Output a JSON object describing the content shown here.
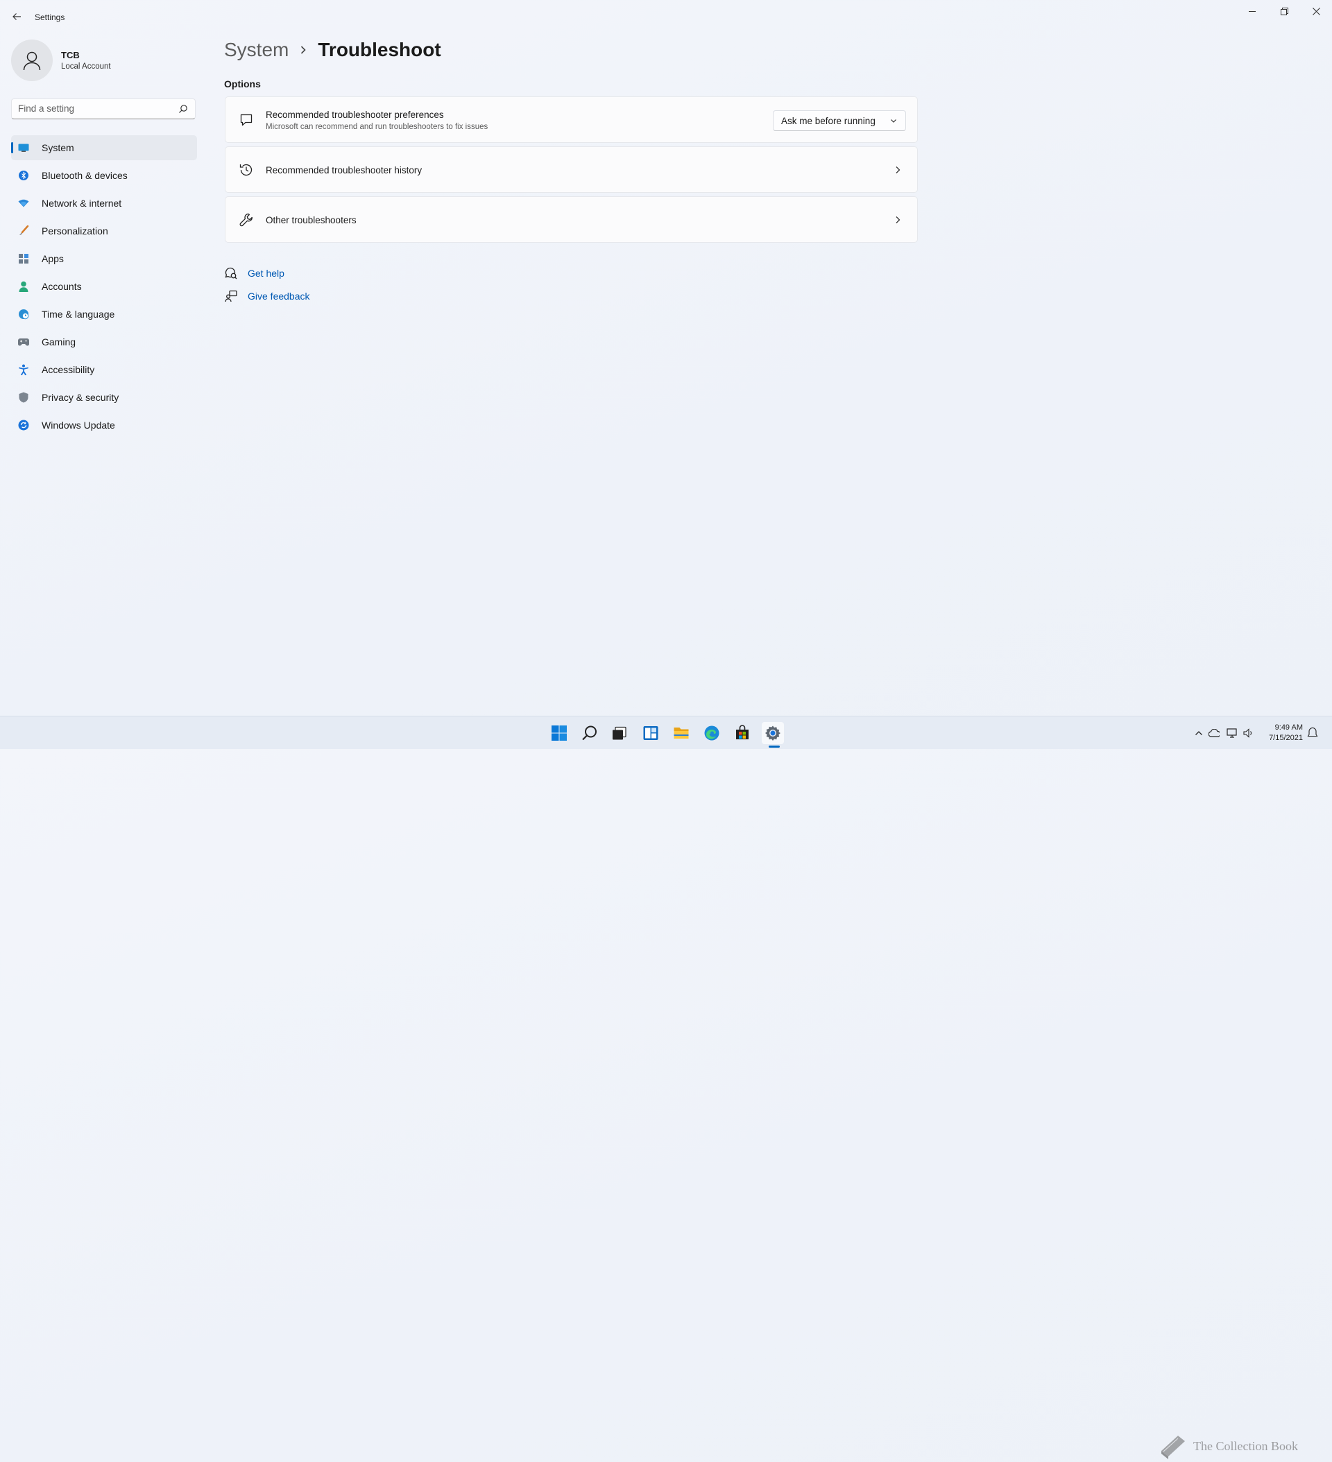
{
  "window": {
    "title": "Settings"
  },
  "profile": {
    "name": "TCB",
    "account_type": "Local Account"
  },
  "search": {
    "placeholder": "Find a setting"
  },
  "sidebar": {
    "items": [
      {
        "label": "System",
        "icon": "system-icon",
        "active": true
      },
      {
        "label": "Bluetooth & devices",
        "icon": "bluetooth-icon"
      },
      {
        "label": "Network & internet",
        "icon": "wifi-icon"
      },
      {
        "label": "Personalization",
        "icon": "brush-icon"
      },
      {
        "label": "Apps",
        "icon": "apps-icon"
      },
      {
        "label": "Accounts",
        "icon": "person-icon"
      },
      {
        "label": "Time & language",
        "icon": "globe-clock-icon"
      },
      {
        "label": "Gaming",
        "icon": "gamepad-icon"
      },
      {
        "label": "Accessibility",
        "icon": "accessibility-icon"
      },
      {
        "label": "Privacy & security",
        "icon": "shield-icon"
      },
      {
        "label": "Windows Update",
        "icon": "update-icon"
      }
    ]
  },
  "breadcrumb": {
    "parent": "System",
    "current": "Troubleshoot"
  },
  "options": {
    "heading": "Options",
    "preferences": {
      "title": "Recommended troubleshooter preferences",
      "description": "Microsoft can recommend and run troubleshooters to fix issues",
      "selected": "Ask me before running"
    },
    "history": {
      "title": "Recommended troubleshooter history"
    },
    "other": {
      "title": "Other troubleshooters"
    }
  },
  "help": {
    "get_help": "Get help",
    "give_feedback": "Give feedback"
  },
  "taskbar": {
    "pinned": [
      "start-icon",
      "search-icon",
      "task-view-icon",
      "widgets-icon",
      "file-explorer-icon",
      "edge-icon",
      "store-icon",
      "settings-icon"
    ],
    "active": "settings-icon"
  },
  "tray": {
    "time": "9:49 AM",
    "date": "7/15/2021"
  },
  "watermark": {
    "text": "The Collection Book"
  },
  "colors": {
    "accent": "#0067c0",
    "link": "#0059b3"
  }
}
